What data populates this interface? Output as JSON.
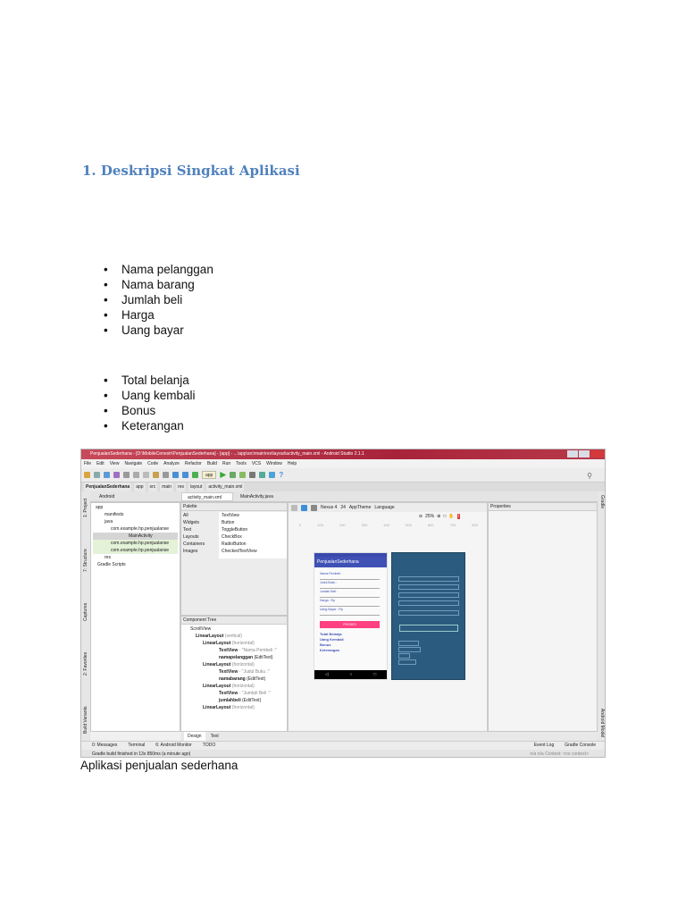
{
  "heading": "1. Deskripsi Singkat Aplikasi",
  "inputs_list": [
    "Nama pelanggan",
    "Nama barang",
    "Jumlah beli",
    "Harga",
    "Uang bayar"
  ],
  "outputs_list": [
    "Total belanja",
    "Uang kembali",
    "Bonus",
    "Keterangan"
  ],
  "caption": "Aplikasi penjualan sederhana",
  "ide": {
    "title": "PenjualanSederhana - [D:\\MobileCenestr\\PenjualanSederhana] - [app] - ...\\app\\src\\main\\res\\layout\\activity_main.xml - Android Studio 2.1.1",
    "menu": [
      "File",
      "Edit",
      "View",
      "Navigate",
      "Code",
      "Analyze",
      "Refactor",
      "Build",
      "Run",
      "Tools",
      "VCS",
      "Window",
      "Help"
    ],
    "run_config": "app",
    "breadcrumbs": [
      "PenjualanSederhana",
      "app",
      "src",
      "main",
      "res",
      "layout",
      "activity_main.xml"
    ],
    "project_view": "Android",
    "editor_tabs": [
      "activity_main.xml",
      "MainActivity.java"
    ],
    "project_tree": [
      "app",
      "manifests",
      "java",
      "com.example.hp.penjualanse",
      "MainActivity",
      "com.example.hp.penjualanse",
      "com.example.hp.penjualanse",
      "res",
      "Gradle Scripts"
    ],
    "left_tools": [
      "1: Project",
      "7: Structure",
      "Captures",
      "2: Favorites",
      "Build Variants"
    ],
    "right_tools": [
      "Gradle",
      "Android Model"
    ],
    "palette_title": "Palette",
    "palette_groups": [
      "All",
      "Widgets",
      "Text",
      "Layouts",
      "Containers",
      "Images"
    ],
    "palette_items": [
      "TextView",
      "Button",
      "ToggleButton",
      "CheckBox",
      "RadioButton",
      "CheckedTextView"
    ],
    "device": "Nexus 4",
    "api": "24",
    "theme": "AppTheme",
    "language": "Language",
    "zoom": "25%",
    "ruler": [
      "0",
      "100",
      "200",
      "300",
      "400",
      "500",
      "600",
      "700",
      "800"
    ],
    "properties_title": "Properties",
    "component_tree_title": "Component Tree",
    "component_tree": [
      {
        "name": "ScrollView",
        "extra": ""
      },
      {
        "name": "LinearLayout",
        "extra": "(vertical)"
      },
      {
        "name": "LinearLayout",
        "extra": "(horizontal)"
      },
      {
        "name": "TextView",
        "extra": "- \"Nama Pembeli :\""
      },
      {
        "name": "namapelanggan",
        "extra": "(EditText)"
      },
      {
        "name": "LinearLayout",
        "extra": "(horizontal)"
      },
      {
        "name": "TextView",
        "extra": "- \"Judul Buku :\""
      },
      {
        "name": "namabarang",
        "extra": "(EditText)"
      },
      {
        "name": "LinearLayout",
        "extra": "(horizontal)"
      },
      {
        "name": "TextView",
        "extra": "- \"Jumlah Beli :\""
      },
      {
        "name": "jumlahbeli",
        "extra": "(EditText)"
      },
      {
        "name": "LinearLayout",
        "extra": "(horizontal)"
      }
    ],
    "preview": {
      "app_title": "PenjualanSederhana",
      "labels": [
        "Nama Pembeli :",
        "Judul Buku :",
        "Jumlah Beli :",
        "Harga : Rp",
        "Uang Bayar : Rp"
      ],
      "button": "PROSES",
      "outputs": [
        "Total Belanja",
        "Uang Kembali",
        "Bonus",
        "Keterangan"
      ]
    },
    "bottom_tabs": [
      "Design",
      "Text"
    ],
    "tool_tabs": [
      "0: Messages",
      "Terminal",
      "6: Android Monitor",
      "TODO"
    ],
    "right_tool_tabs": [
      "Event Log",
      "Gradle Console"
    ],
    "status": "Gradle build finished in 13s 850ms (a minute ago)",
    "status_right": "n/a   n/a   Context: <no context>"
  }
}
